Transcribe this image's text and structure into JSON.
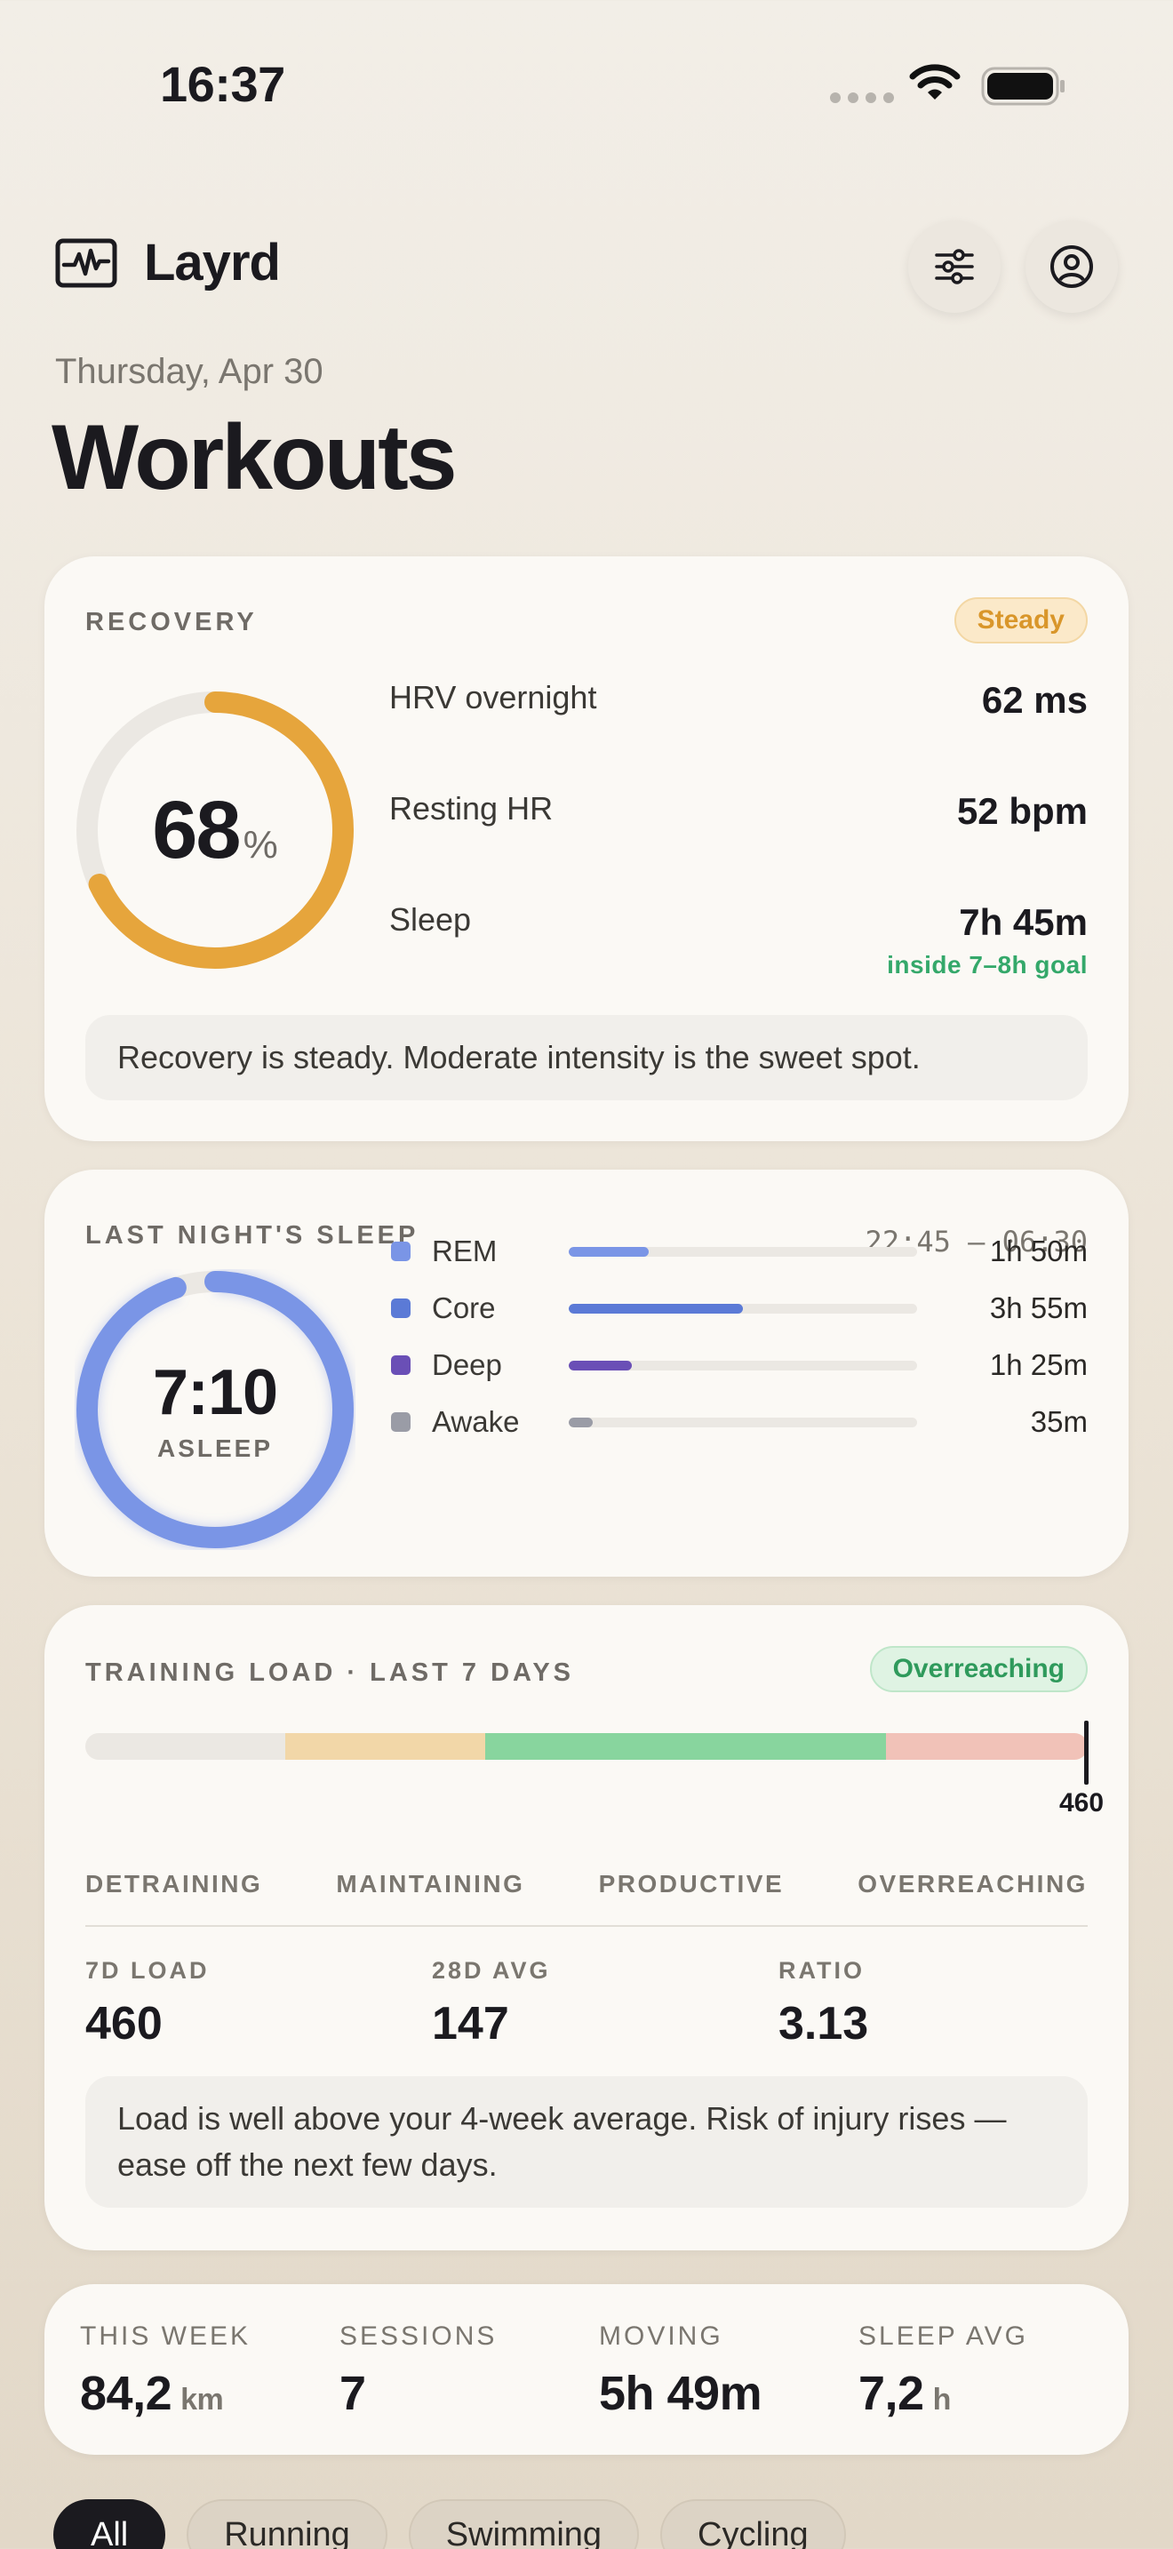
{
  "status_bar": {
    "time": "16:37"
  },
  "header": {
    "brand": "Layrd",
    "date": "Thursday, Apr 30",
    "title": "Workouts"
  },
  "recovery": {
    "label": "RECOVERY",
    "badge": "Steady",
    "score": "68",
    "score_unit": "%",
    "score_fraction": 0.68,
    "metrics": [
      {
        "name": "HRV overnight",
        "value": "62 ms"
      },
      {
        "name": "Resting HR",
        "value": "52 bpm"
      },
      {
        "name": "Sleep",
        "value": "7h 45m",
        "note": "inside 7–8h goal"
      }
    ],
    "note": "Recovery is steady. Moderate intensity is the sweet spot.",
    "colors": {
      "accent": "#e6a53c",
      "track": "#ebe8e3",
      "positive": "#34a86a"
    }
  },
  "sleep": {
    "label": "LAST NIGHT'S SLEEP",
    "time_range": "22:45 — 06:30",
    "value": "7:10",
    "sub": "ASLEEP",
    "ring_fraction": 0.95,
    "ring_color": "#7a95e6",
    "stages": [
      {
        "name": "REM",
        "duration": "1h 50m",
        "fraction": 0.23,
        "color": "#7a95e6"
      },
      {
        "name": "Core",
        "duration": "3h 55m",
        "fraction": 0.5,
        "color": "#5b7ad6"
      },
      {
        "name": "Deep",
        "duration": "1h 25m",
        "fraction": 0.18,
        "color": "#6a4fb6"
      },
      {
        "name": "Awake",
        "duration": "35m",
        "fraction": 0.07,
        "color": "#9a9ca6"
      }
    ]
  },
  "training": {
    "label": "TRAINING LOAD · LAST 7 DAYS",
    "badge": "Overreaching",
    "marker_value": "460",
    "zones": [
      {
        "name": "DETRAINING",
        "color": "#ebe8e3"
      },
      {
        "name": "MAINTAINING",
        "color": "#f2d7a8"
      },
      {
        "name": "PRODUCTIVE",
        "color": "#88d59e"
      },
      {
        "name": "OVERREACHING",
        "color": "#f1c2b8"
      }
    ],
    "stats": [
      {
        "label": "7D LOAD",
        "value": "460"
      },
      {
        "label": "28D AVG",
        "value": "147"
      },
      {
        "label": "RATIO",
        "value": "3.13"
      }
    ],
    "note": "Load is well above your 4-week average. Risk of injury rises — ease off the next few days."
  },
  "summary": [
    {
      "label": "THIS WEEK",
      "value": "84,2",
      "unit": "km"
    },
    {
      "label": "SESSIONS",
      "value": "7",
      "unit": ""
    },
    {
      "label": "MOVING",
      "value": "5h 49m",
      "unit": ""
    },
    {
      "label": "SLEEP AVG",
      "value": "7,2",
      "unit": "h"
    }
  ],
  "filters": {
    "chips": [
      "All",
      "Running",
      "Swimming",
      "Cycling"
    ],
    "active": "All"
  },
  "icons": {
    "brand": "activity-monitor-icon",
    "filter": "sliders-icon",
    "profile": "user-circle-icon"
  }
}
